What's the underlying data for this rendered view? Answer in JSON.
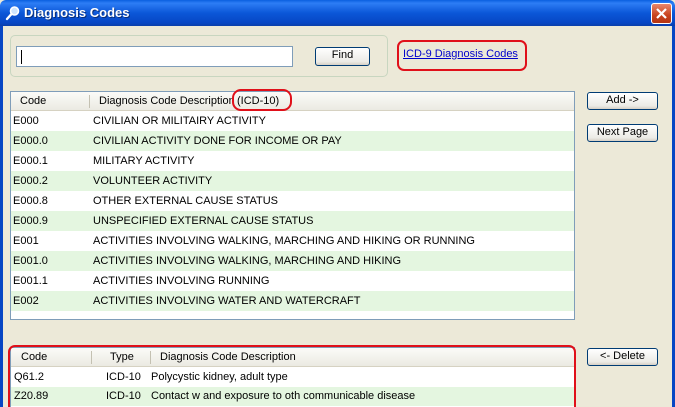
{
  "window": {
    "title": "Diagnosis Codes",
    "icon": "magnifier-icon",
    "close_icon": "close-icon"
  },
  "search": {
    "value": "",
    "find_label": "Find",
    "link_label": "ICD-9 Diagnosis Codes"
  },
  "upper_grid": {
    "col_code": "Code",
    "col_desc": "Diagnosis Code Description",
    "col_desc_suffix": "(ICD-10)",
    "rows": [
      {
        "code": "E000",
        "desc": "CIVILIAN OR MILITAIRY ACTIVITY"
      },
      {
        "code": "E000.0",
        "desc": "CIVILIAN ACTIVITY DONE FOR INCOME OR PAY"
      },
      {
        "code": "E000.1",
        "desc": "MILITARY ACTIVITY"
      },
      {
        "code": "E000.2",
        "desc": "VOLUNTEER ACTIVITY"
      },
      {
        "code": "E000.8",
        "desc": "OTHER EXTERNAL CAUSE STATUS"
      },
      {
        "code": "E000.9",
        "desc": "UNSPECIFIED EXTERNAL CAUSE STATUS"
      },
      {
        "code": "E001",
        "desc": "ACTIVITIES INVOLVING WALKING, MARCHING AND HIKING OR RUNNING"
      },
      {
        "code": "E001.0",
        "desc": "ACTIVITIES INVOLVING WALKING, MARCHING AND HIKING"
      },
      {
        "code": "E001.1",
        "desc": "ACTIVITIES INVOLVING RUNNING"
      },
      {
        "code": "E002",
        "desc": "ACTIVITIES INVOLVING WATER AND WATERCRAFT"
      }
    ]
  },
  "actions": {
    "add_label": "Add ->",
    "next_label": "Next Page",
    "delete_label": "<- Delete"
  },
  "lower_grid": {
    "col_code": "Code",
    "col_type": "Type",
    "col_desc": "Diagnosis Code Description",
    "rows": [
      {
        "code": "Q61.2",
        "type": "ICD-10",
        "desc": "Polycystic kidney, adult type"
      },
      {
        "code": "Z20.89",
        "type": "ICD-10",
        "desc": "Contact w and exposure to oth communicable disease"
      }
    ]
  },
  "colors": {
    "titlebar": "#0b57d8",
    "row_alt": "#e4f6e0",
    "highlight_ring": "#e0101a",
    "link": "#0000cc"
  }
}
